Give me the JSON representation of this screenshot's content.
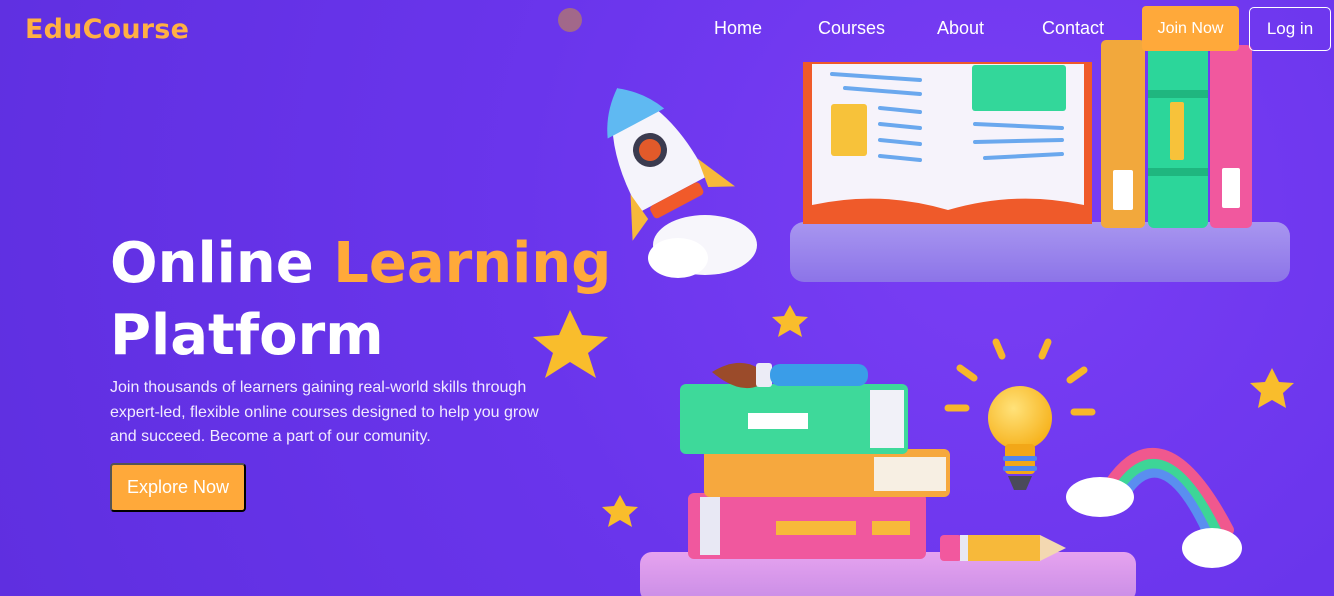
{
  "nav": {
    "brand": "EduCourse",
    "links": [
      "Home",
      "Courses",
      "About",
      "Contact"
    ],
    "join_label": "Join Now",
    "login_label": "Log in"
  },
  "hero": {
    "title_part1": "Online ",
    "title_accent": "Learning",
    "title_part2": "Platform",
    "description": "Join thousands of learners gaining real-world skills through expert-led, flexible online courses designed to help you grow and succeed. Become a part of our comunity.",
    "cta_label": "Explore Now"
  },
  "colors": {
    "background": "#6a35ec",
    "accent": "#ffa93a",
    "text": "#ffffff"
  },
  "illustration": {
    "icons": [
      "rocket-icon",
      "open-book-icon",
      "book-stack-icon",
      "paintbrush-icon",
      "lightbulb-icon",
      "rainbow-icon",
      "pencil-icon",
      "star-icon",
      "cloud-icon",
      "shelf-icon"
    ]
  }
}
